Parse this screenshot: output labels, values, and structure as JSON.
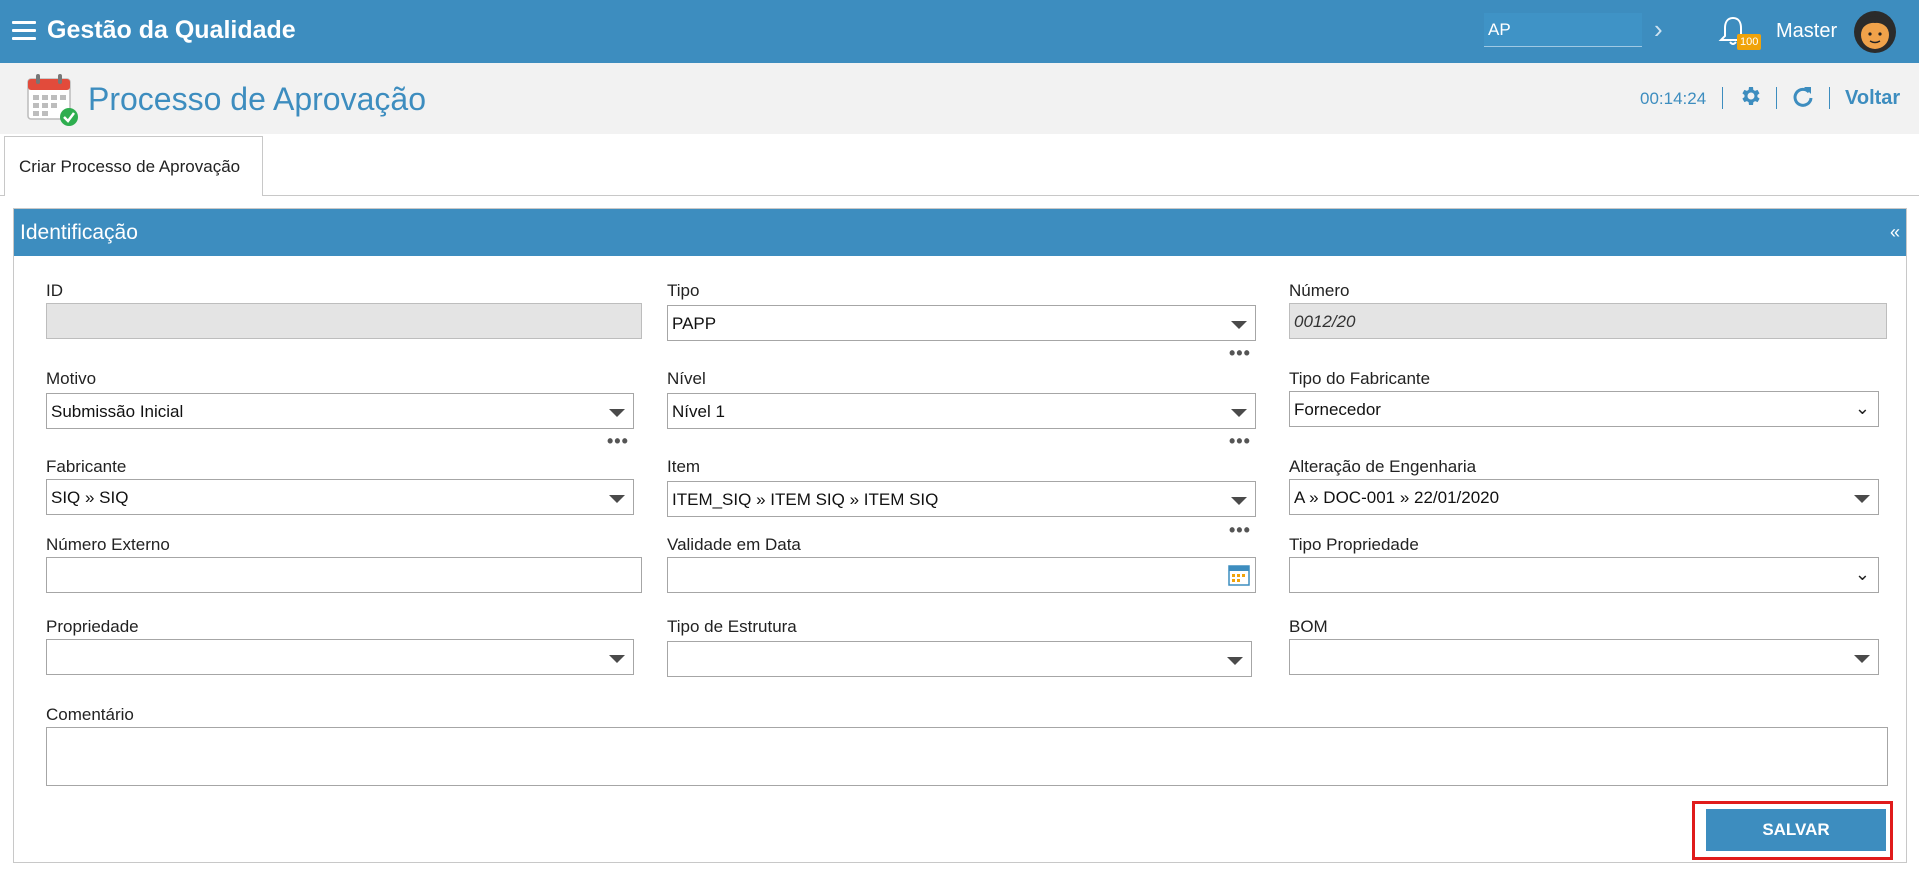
{
  "header": {
    "app_title": "Gestão da Qualidade",
    "search_value": "AP",
    "notifications_count": "100",
    "user_name": "Master"
  },
  "page": {
    "title": "Processo de Aprovação",
    "timer": "00:14:24",
    "back_label": "Voltar"
  },
  "tabs": [
    {
      "label": "Criar Processo de Aprovação"
    }
  ],
  "panel": {
    "title": "Identificação",
    "collapse_symbol": "«"
  },
  "form": {
    "id": {
      "label": "ID",
      "value": ""
    },
    "tipo": {
      "label": "Tipo",
      "value": "PAPP"
    },
    "numero": {
      "label": "Número",
      "value": "0012/20"
    },
    "motivo": {
      "label": "Motivo",
      "value": "Submissão Inicial"
    },
    "nivel": {
      "label": "Nível",
      "value": "Nível 1"
    },
    "tipo_fabricante": {
      "label": "Tipo do Fabricante",
      "value": "Fornecedor"
    },
    "fabricante": {
      "label": "Fabricante",
      "value": "SIQ » SIQ"
    },
    "item": {
      "label": "Item",
      "value": "ITEM_SIQ » ITEM SIQ » ITEM SIQ"
    },
    "alteracao_engenharia": {
      "label": "Alteração de Engenharia",
      "value": "A » DOC-001 » 22/01/2020"
    },
    "numero_externo": {
      "label": "Número Externo",
      "value": ""
    },
    "validade_data": {
      "label": "Validade em Data",
      "value": ""
    },
    "tipo_propriedade": {
      "label": "Tipo Propriedade",
      "value": ""
    },
    "propriedade": {
      "label": "Propriedade",
      "value": ""
    },
    "tipo_estrutura": {
      "label": "Tipo de Estrutura",
      "value": ""
    },
    "bom": {
      "label": "BOM",
      "value": ""
    },
    "comentario": {
      "label": "Comentário",
      "value": ""
    },
    "more_symbol": "•••"
  },
  "actions": {
    "save_label": "SALVAR"
  },
  "colors": {
    "primary": "#3d8dbf",
    "highlight_frame": "#e01b1b",
    "badge": "#f0a30a"
  }
}
